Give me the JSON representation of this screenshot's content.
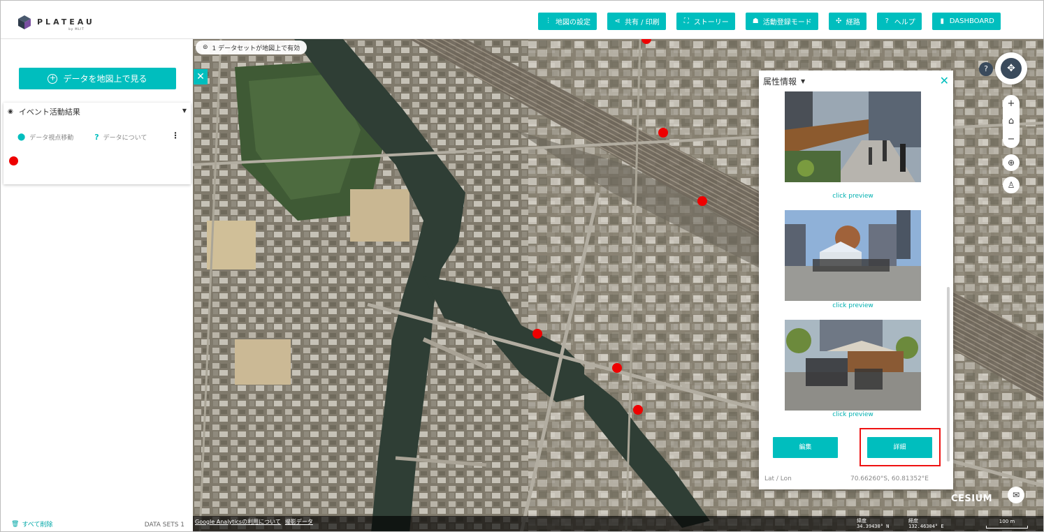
{
  "header": {
    "logo_text": "PLATEAU",
    "logo_sub": "by MLIT",
    "nav": [
      {
        "label": "地図の設定",
        "icon": "sliders-icon"
      },
      {
        "label": "共有 / 印刷",
        "icon": "share-icon"
      },
      {
        "label": "ストーリー",
        "icon": "story-icon"
      },
      {
        "label": "活動登録モード",
        "icon": "users-icon"
      },
      {
        "label": "経路",
        "icon": "route-icon"
      },
      {
        "label": "ヘルプ",
        "icon": "help-icon"
      },
      {
        "label": "DASHBOARD",
        "icon": "book-icon"
      }
    ]
  },
  "sidebar": {
    "add_data_label": "データを地図上で見る",
    "dataset": {
      "title": "イベント活動結果",
      "action_move": "データ視点移動",
      "action_about": "データについて"
    },
    "clear_all": "すべて削除",
    "data_sets_count": "DATA SETS 1"
  },
  "map": {
    "status": "1 データセットが地図上で有効",
    "attribution_links": [
      "Google Analyticsの利用について",
      "撮影データ"
    ],
    "lat_label": "緯度",
    "lat_value": "34.39430° N",
    "lon_label": "経度",
    "lon_value": "132.46304° E",
    "scale": "100 m",
    "brand": "CESIUM"
  },
  "info_panel": {
    "title": "属性情報",
    "preview_label": "click preview",
    "edit_label": "編集",
    "detail_label": "詳細",
    "latlon_label": "Lat / Lon",
    "latlon_value": "70.66260°S, 60.81352°E"
  },
  "colors": {
    "accent": "#00bebe",
    "marker": "#ee0000",
    "highlight": "#ee1111"
  }
}
